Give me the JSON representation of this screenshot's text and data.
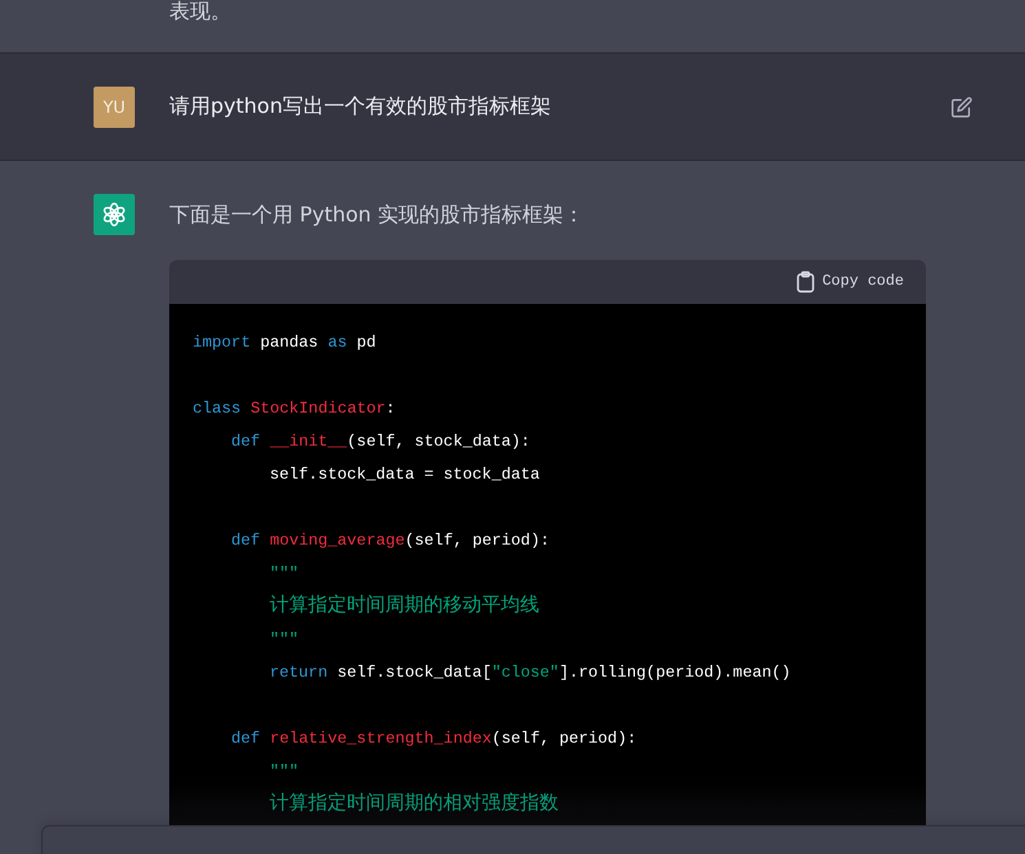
{
  "previous_message": {
    "text": "表现。"
  },
  "user_message": {
    "avatar": "YU",
    "text": "请用python写出一个有效的股市指标框架"
  },
  "assistant_message": {
    "intro": "下面是一个用 Python 实现的股市指标框架：",
    "code_block": {
      "copy_label": "Copy code",
      "lines": [
        {
          "kind": "code",
          "tokens": [
            {
              "kind": "keyword",
              "text": "import "
            },
            {
              "kind": "plain",
              "text": "pandas "
            },
            {
              "kind": "keyword",
              "text": "as "
            },
            {
              "kind": "plain",
              "text": "pd"
            }
          ]
        },
        {
          "kind": "blank"
        },
        {
          "kind": "code",
          "tokens": [
            {
              "kind": "keyword",
              "text": "class "
            },
            {
              "kind": "name",
              "text": "StockIndicator"
            },
            {
              "kind": "plain",
              "text": ":"
            }
          ],
          "children": [
            {
              "kind": "code",
              "tokens": [
                {
                  "kind": "keyword",
                  "text": "def "
                },
                {
                  "kind": "name",
                  "text": "__init__"
                },
                {
                  "kind": "plain",
                  "text": "(self, stock_data):"
                }
              ],
              "children": [
                {
                  "kind": "code",
                  "tokens": [
                    {
                      "kind": "plain",
                      "text": "self.stock_data = stock_data"
                    }
                  ]
                }
              ]
            },
            {
              "kind": "blank"
            },
            {
              "kind": "code",
              "tokens": [
                {
                  "kind": "keyword",
                  "text": "def "
                },
                {
                  "kind": "name",
                  "text": "moving_average"
                },
                {
                  "kind": "plain",
                  "text": "(self, period):"
                }
              ],
              "children": [
                {
                  "kind": "code",
                  "tokens": [
                    {
                      "kind": "string",
                      "text": "\"\"\""
                    }
                  ]
                },
                {
                  "kind": "code",
                  "tokens": [
                    {
                      "kind": "string",
                      "text": "计算指定时间周期的移动平均线"
                    }
                  ]
                },
                {
                  "kind": "code",
                  "tokens": [
                    {
                      "kind": "string",
                      "text": "\"\"\""
                    }
                  ]
                },
                {
                  "kind": "code",
                  "tokens": [
                    {
                      "kind": "keyword",
                      "text": "return "
                    },
                    {
                      "kind": "plain",
                      "text": "self.stock_data["
                    },
                    {
                      "kind": "string",
                      "text": "\"close\""
                    },
                    {
                      "kind": "plain",
                      "text": "].rolling(period).mean()"
                    }
                  ]
                }
              ]
            },
            {
              "kind": "blank"
            },
            {
              "kind": "code",
              "tokens": [
                {
                  "kind": "keyword",
                  "text": "def "
                },
                {
                  "kind": "name",
                  "text": "relative_strength_index"
                },
                {
                  "kind": "plain",
                  "text": "(self, period):"
                }
              ],
              "children": [
                {
                  "kind": "code",
                  "tokens": [
                    {
                      "kind": "string",
                      "text": "\"\"\""
                    }
                  ]
                },
                {
                  "kind": "code",
                  "tokens": [
                    {
                      "kind": "string",
                      "text": "计算指定时间周期的相对强度指数"
                    }
                  ]
                }
              ]
            }
          ]
        }
      ]
    }
  }
}
